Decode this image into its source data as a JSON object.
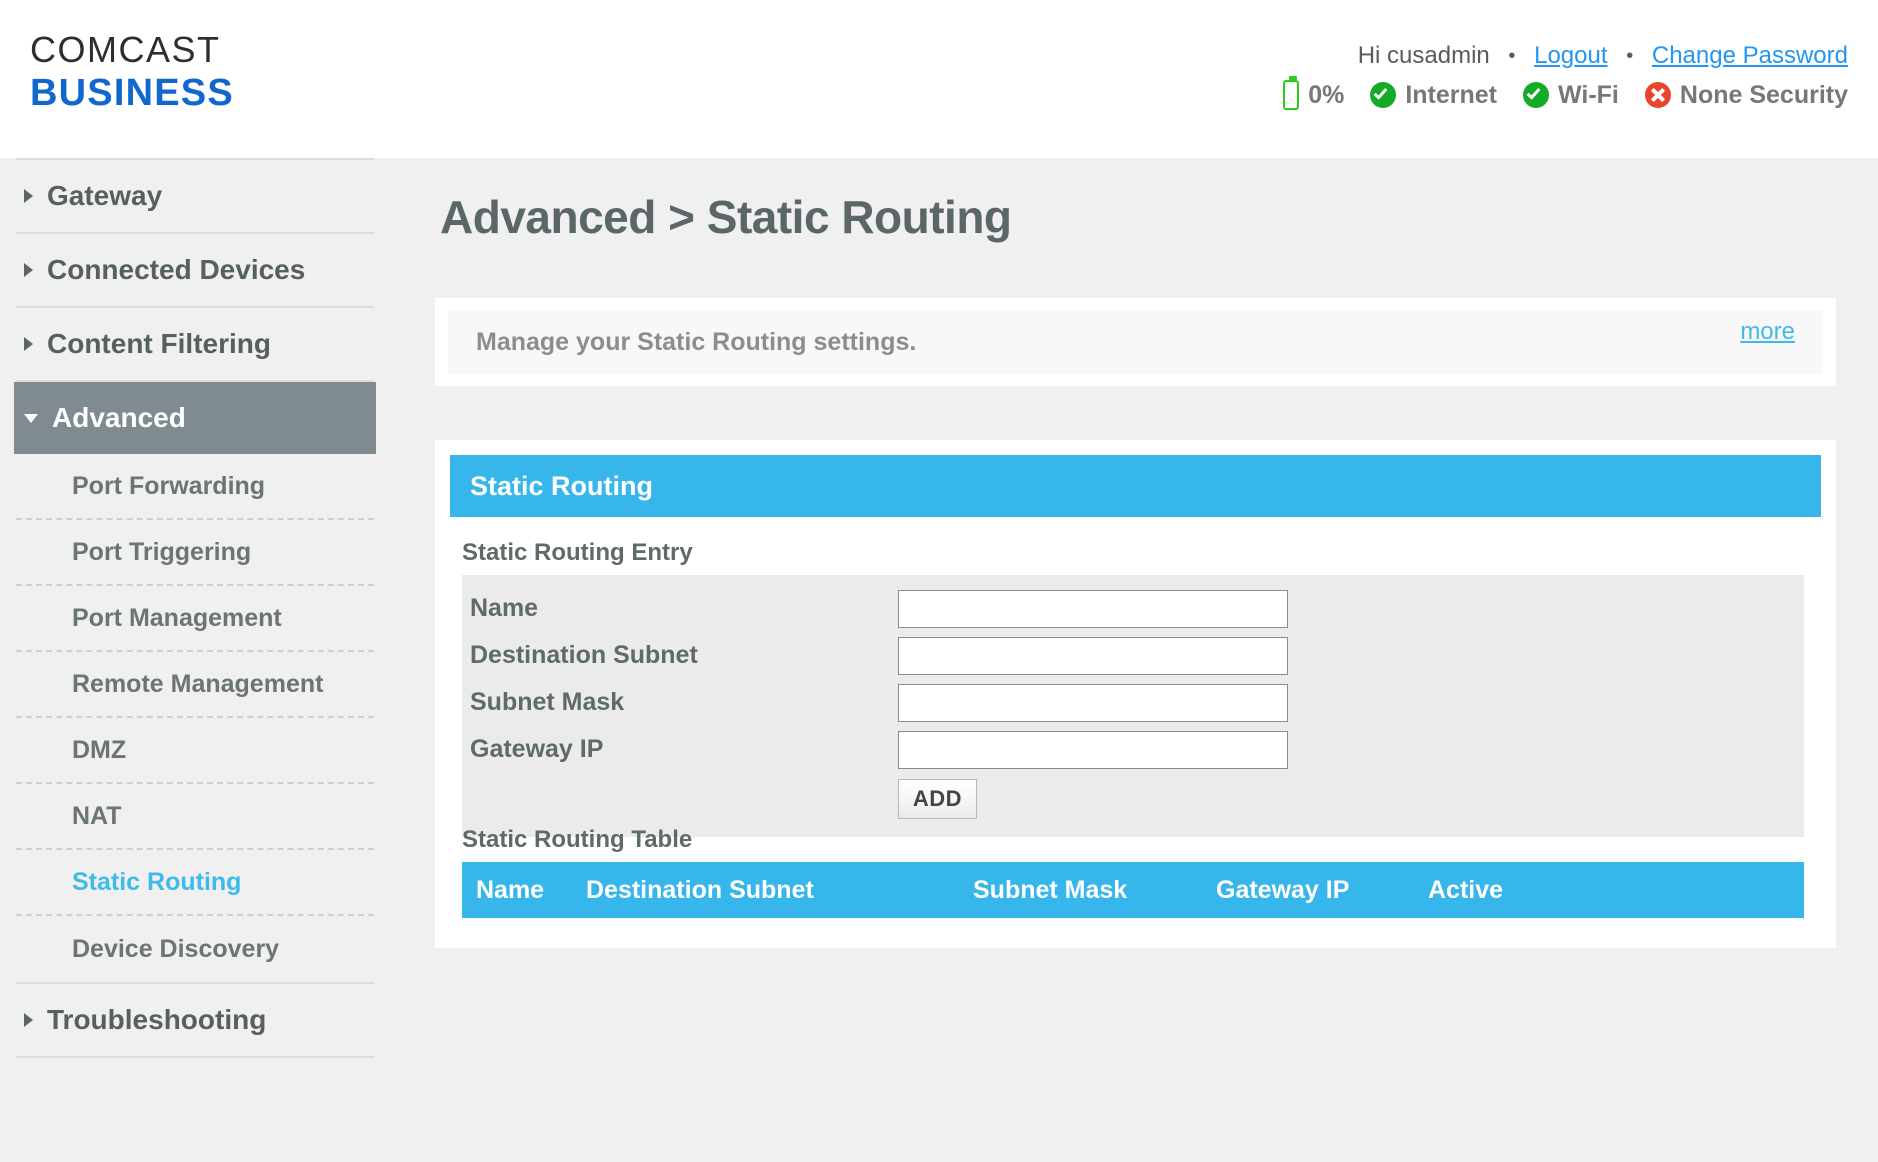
{
  "header": {
    "logo_line1": "COMCAST",
    "logo_line2": "BUSINESS",
    "greeting": "Hi cusadmin",
    "separator": "•",
    "logout_label": "Logout",
    "change_password_label": "Change Password",
    "status": [
      {
        "icon": "battery-icon",
        "label": "0%"
      },
      {
        "icon": "check-circle-icon",
        "label": "Internet"
      },
      {
        "icon": "check-circle-icon",
        "label": "Wi-Fi"
      },
      {
        "icon": "error-circle-icon",
        "label": "None Security"
      }
    ]
  },
  "sidebar": {
    "top_items": [
      {
        "label": "Gateway",
        "expanded": false,
        "active": false
      },
      {
        "label": "Connected Devices",
        "expanded": false,
        "active": false
      },
      {
        "label": "Content Filtering",
        "expanded": false,
        "active": false
      },
      {
        "label": "Advanced",
        "expanded": true,
        "active": true
      },
      {
        "label": "Troubleshooting",
        "expanded": false,
        "active": false
      }
    ],
    "advanced_subitems": [
      {
        "label": "Port Forwarding",
        "active": false
      },
      {
        "label": "Port Triggering",
        "active": false
      },
      {
        "label": "Port Management",
        "active": false
      },
      {
        "label": "Remote Management",
        "active": false
      },
      {
        "label": "DMZ",
        "active": false
      },
      {
        "label": "NAT",
        "active": false
      },
      {
        "label": "Static Routing",
        "active": true
      },
      {
        "label": "Device Discovery",
        "active": false
      }
    ]
  },
  "main": {
    "page_title": "Advanced > Static Routing",
    "description": "Manage your Static Routing settings.",
    "more_label": "more",
    "panel_title": "Static Routing",
    "entry_section_title": "Static Routing Entry",
    "table_section_title": "Static Routing Table",
    "form": {
      "fields": [
        {
          "label": "Name",
          "value": "",
          "placeholder": ""
        },
        {
          "label": "Destination Subnet",
          "value": "",
          "placeholder": ""
        },
        {
          "label": "Subnet Mask",
          "value": "",
          "placeholder": ""
        },
        {
          "label": "Gateway IP",
          "value": "",
          "placeholder": ""
        }
      ],
      "add_button_label": "ADD"
    },
    "table": {
      "columns": [
        "Name",
        "Destination Subnet",
        "Subnet Mask",
        "Gateway IP",
        "Active"
      ],
      "rows": []
    }
  },
  "colors": {
    "accent_blue": "#37b6ec",
    "link_blue": "#2196f3",
    "brand_blue": "#1267cf",
    "active_nav_gray": "#7f8a91",
    "page_bg": "#f0f0f0",
    "status_ok_green": "#16ab26",
    "status_error_red": "#e8452c",
    "battery_green": "#2ecc1e"
  }
}
